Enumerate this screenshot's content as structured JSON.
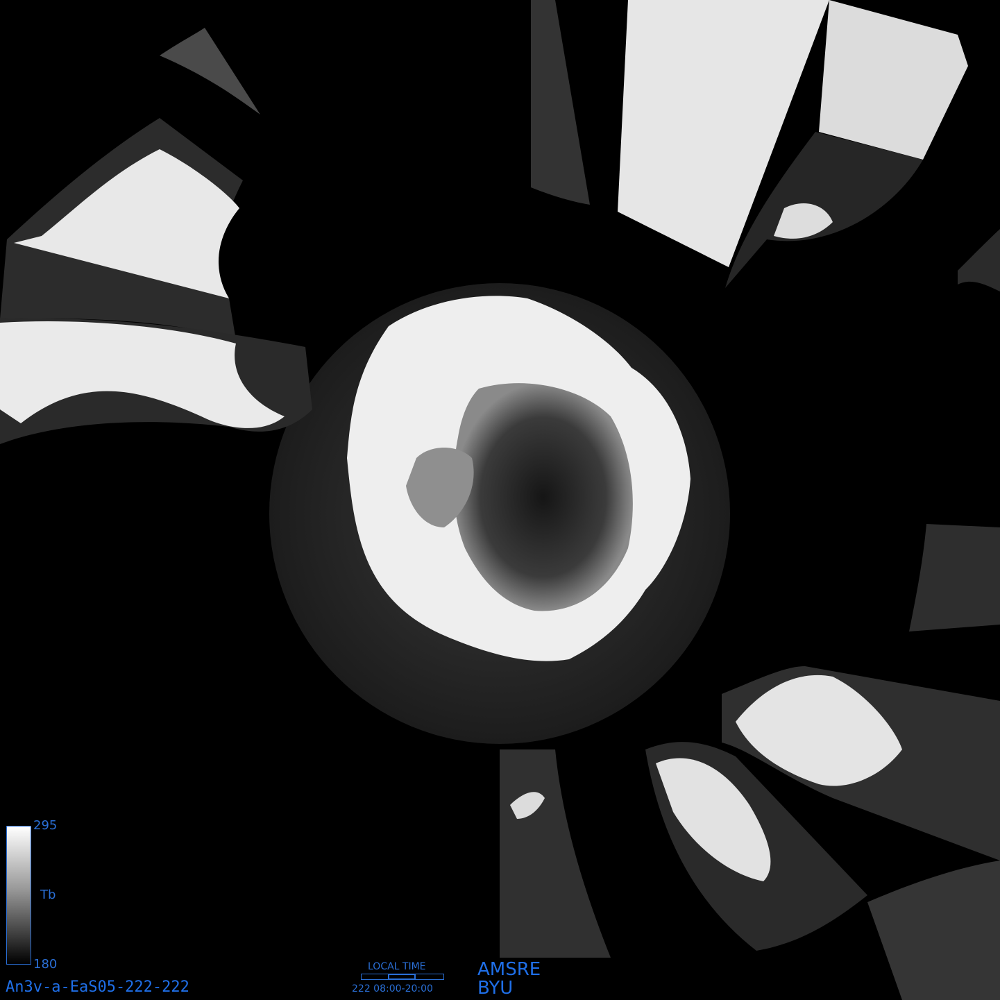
{
  "colorbar": {
    "max_label": "295",
    "min_label": "180",
    "unit_label": "Tb",
    "border_color": "#2a6fd6"
  },
  "product_id": "An3v-a-EaS05-222-222",
  "local_time": {
    "title": "LOCAL TIME",
    "range_text": "222  08:00-20:00"
  },
  "sensor": "AMSRE",
  "organization": "BYU",
  "colors": {
    "label_blue": "#1f6fe8",
    "background": "#000000"
  }
}
